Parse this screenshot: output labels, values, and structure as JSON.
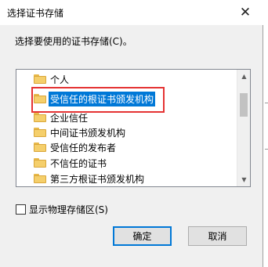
{
  "window": {
    "title": "选择证书存储",
    "close_glyph": "✕"
  },
  "prompt": "选择要使用的证书存储(C)。",
  "tree": {
    "items": [
      {
        "label": "个人",
        "selected": false
      },
      {
        "label": "受信任的根证书颁发机构",
        "selected": true
      },
      {
        "label": "企业信任",
        "selected": false
      },
      {
        "label": "中间证书颁发机构",
        "selected": false
      },
      {
        "label": "受信任的发布者",
        "selected": false
      },
      {
        "label": "不信任的证书",
        "selected": false
      },
      {
        "label": "第三方根证书颁发机构",
        "selected": false
      }
    ],
    "scroll_up_glyph": "▲",
    "scroll_down_glyph": "▼"
  },
  "checkbox": {
    "label": "显示物理存储区(S)",
    "checked": false
  },
  "buttons": {
    "ok": "确定",
    "cancel": "取消"
  },
  "colors": {
    "selection": "#0078d7",
    "annotation_box": "#e53333",
    "folder": "#f5cf6b"
  }
}
